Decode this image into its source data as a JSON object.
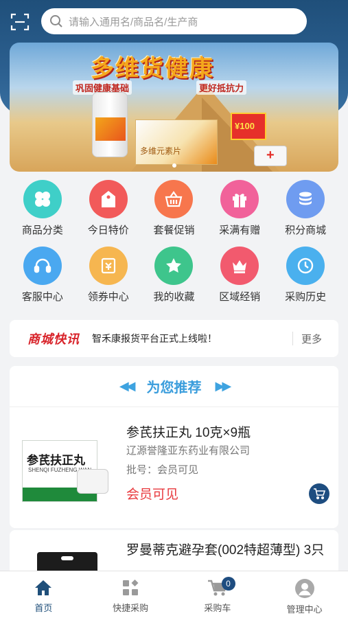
{
  "search": {
    "placeholder": "请输入通用名/商品名/生产商"
  },
  "banner": {
    "title": "多维货健康",
    "slogan_left": "巩固健康基础",
    "slogan_right": "更好抵抗力",
    "box_text": "多维元素片",
    "promo": "¥100"
  },
  "categories": [
    {
      "label": "商品分类",
      "color": "#3fcfc8",
      "icon": "grid-icon"
    },
    {
      "label": "今日特价",
      "color": "#f25a5a",
      "icon": "price-tag-icon"
    },
    {
      "label": "套餐促销",
      "color": "#f7764d",
      "icon": "basket-icon"
    },
    {
      "label": "采满有赠",
      "color": "#f1629a",
      "icon": "gift-icon"
    },
    {
      "label": "积分商城",
      "color": "#6f9cf0",
      "icon": "coins-icon"
    },
    {
      "label": "客服中心",
      "color": "#4aa8f0",
      "icon": "headset-icon"
    },
    {
      "label": "领券中心",
      "color": "#f6b650",
      "icon": "coupon-icon"
    },
    {
      "label": "我的收藏",
      "color": "#3ec58c",
      "icon": "star-icon"
    },
    {
      "label": "区域经销",
      "color": "#f25a6e",
      "icon": "crown-icon"
    },
    {
      "label": "采购历史",
      "color": "#4ab0ee",
      "icon": "clock-icon"
    }
  ],
  "news": {
    "logo": "商城快讯",
    "text": "智禾康报货平台正式上线啦！",
    "more": "更多"
  },
  "recommend": {
    "title": "为您推荐",
    "arrow_left": "◀◀",
    "arrow_right": "▶▶"
  },
  "products": [
    {
      "name": "参芪扶正丸 10克×9瓶",
      "maker": "辽源誉隆亚东药业有限公司",
      "batch": "批号：会员可见",
      "price": "会员可见",
      "box_name": "参芪扶正丸",
      "box_pinyin": "SHENQI FUZHENG WAN"
    },
    {
      "name": "罗曼蒂克避孕套(002特超薄型) 3只"
    }
  ],
  "tabbar": [
    {
      "label": "首页",
      "icon": "home-icon",
      "active": true
    },
    {
      "label": "快捷采购",
      "icon": "quick-buy-icon"
    },
    {
      "label": "采购车",
      "icon": "cart-icon",
      "badge": "0"
    },
    {
      "label": "管理中心",
      "icon": "user-icon"
    }
  ],
  "colors": {
    "primary": "#1f4f7a",
    "accent_blue": "#3a9ddc",
    "price_red": "#e8393d"
  }
}
